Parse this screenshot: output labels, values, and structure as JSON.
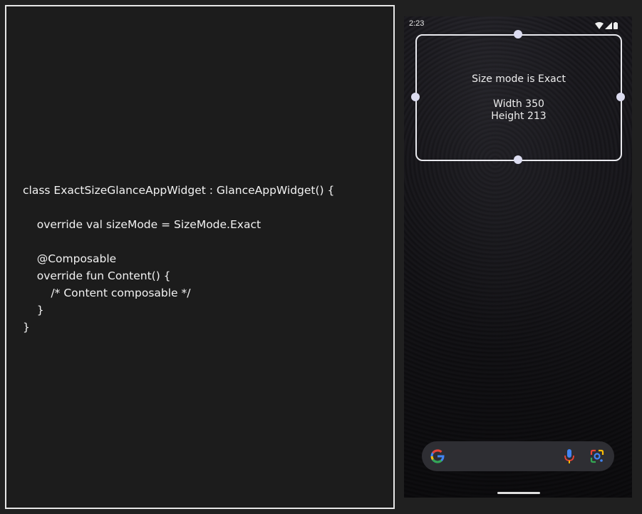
{
  "code": {
    "lines": [
      "class ExactSizeGlanceAppWidget : GlanceAppWidget() {",
      "",
      "    override val sizeMode = SizeMode.Exact",
      "",
      "    @Composable",
      "    override fun Content() {",
      "        /* Content composable */",
      "    }",
      "}"
    ]
  },
  "phone": {
    "status_time": "2:23",
    "status_icons": [
      "wifi-icon",
      "cellular-signal-icon",
      "battery-icon"
    ],
    "widget": {
      "title": "Size mode is Exact",
      "width_label": "Width 350",
      "height_label": "Height 213"
    },
    "search_bar": {
      "icons": [
        "google-g-icon",
        "microphone-icon",
        "google-lens-icon"
      ]
    }
  },
  "colors": {
    "page_background": "#202020",
    "code_background": "#1c1c1c",
    "code_border": "#e6e6e6",
    "code_text": "#f2f2f2",
    "widget_border": "#e9e9ee",
    "handle": "#dcdcf0",
    "search_bar": "#2e2e33"
  }
}
